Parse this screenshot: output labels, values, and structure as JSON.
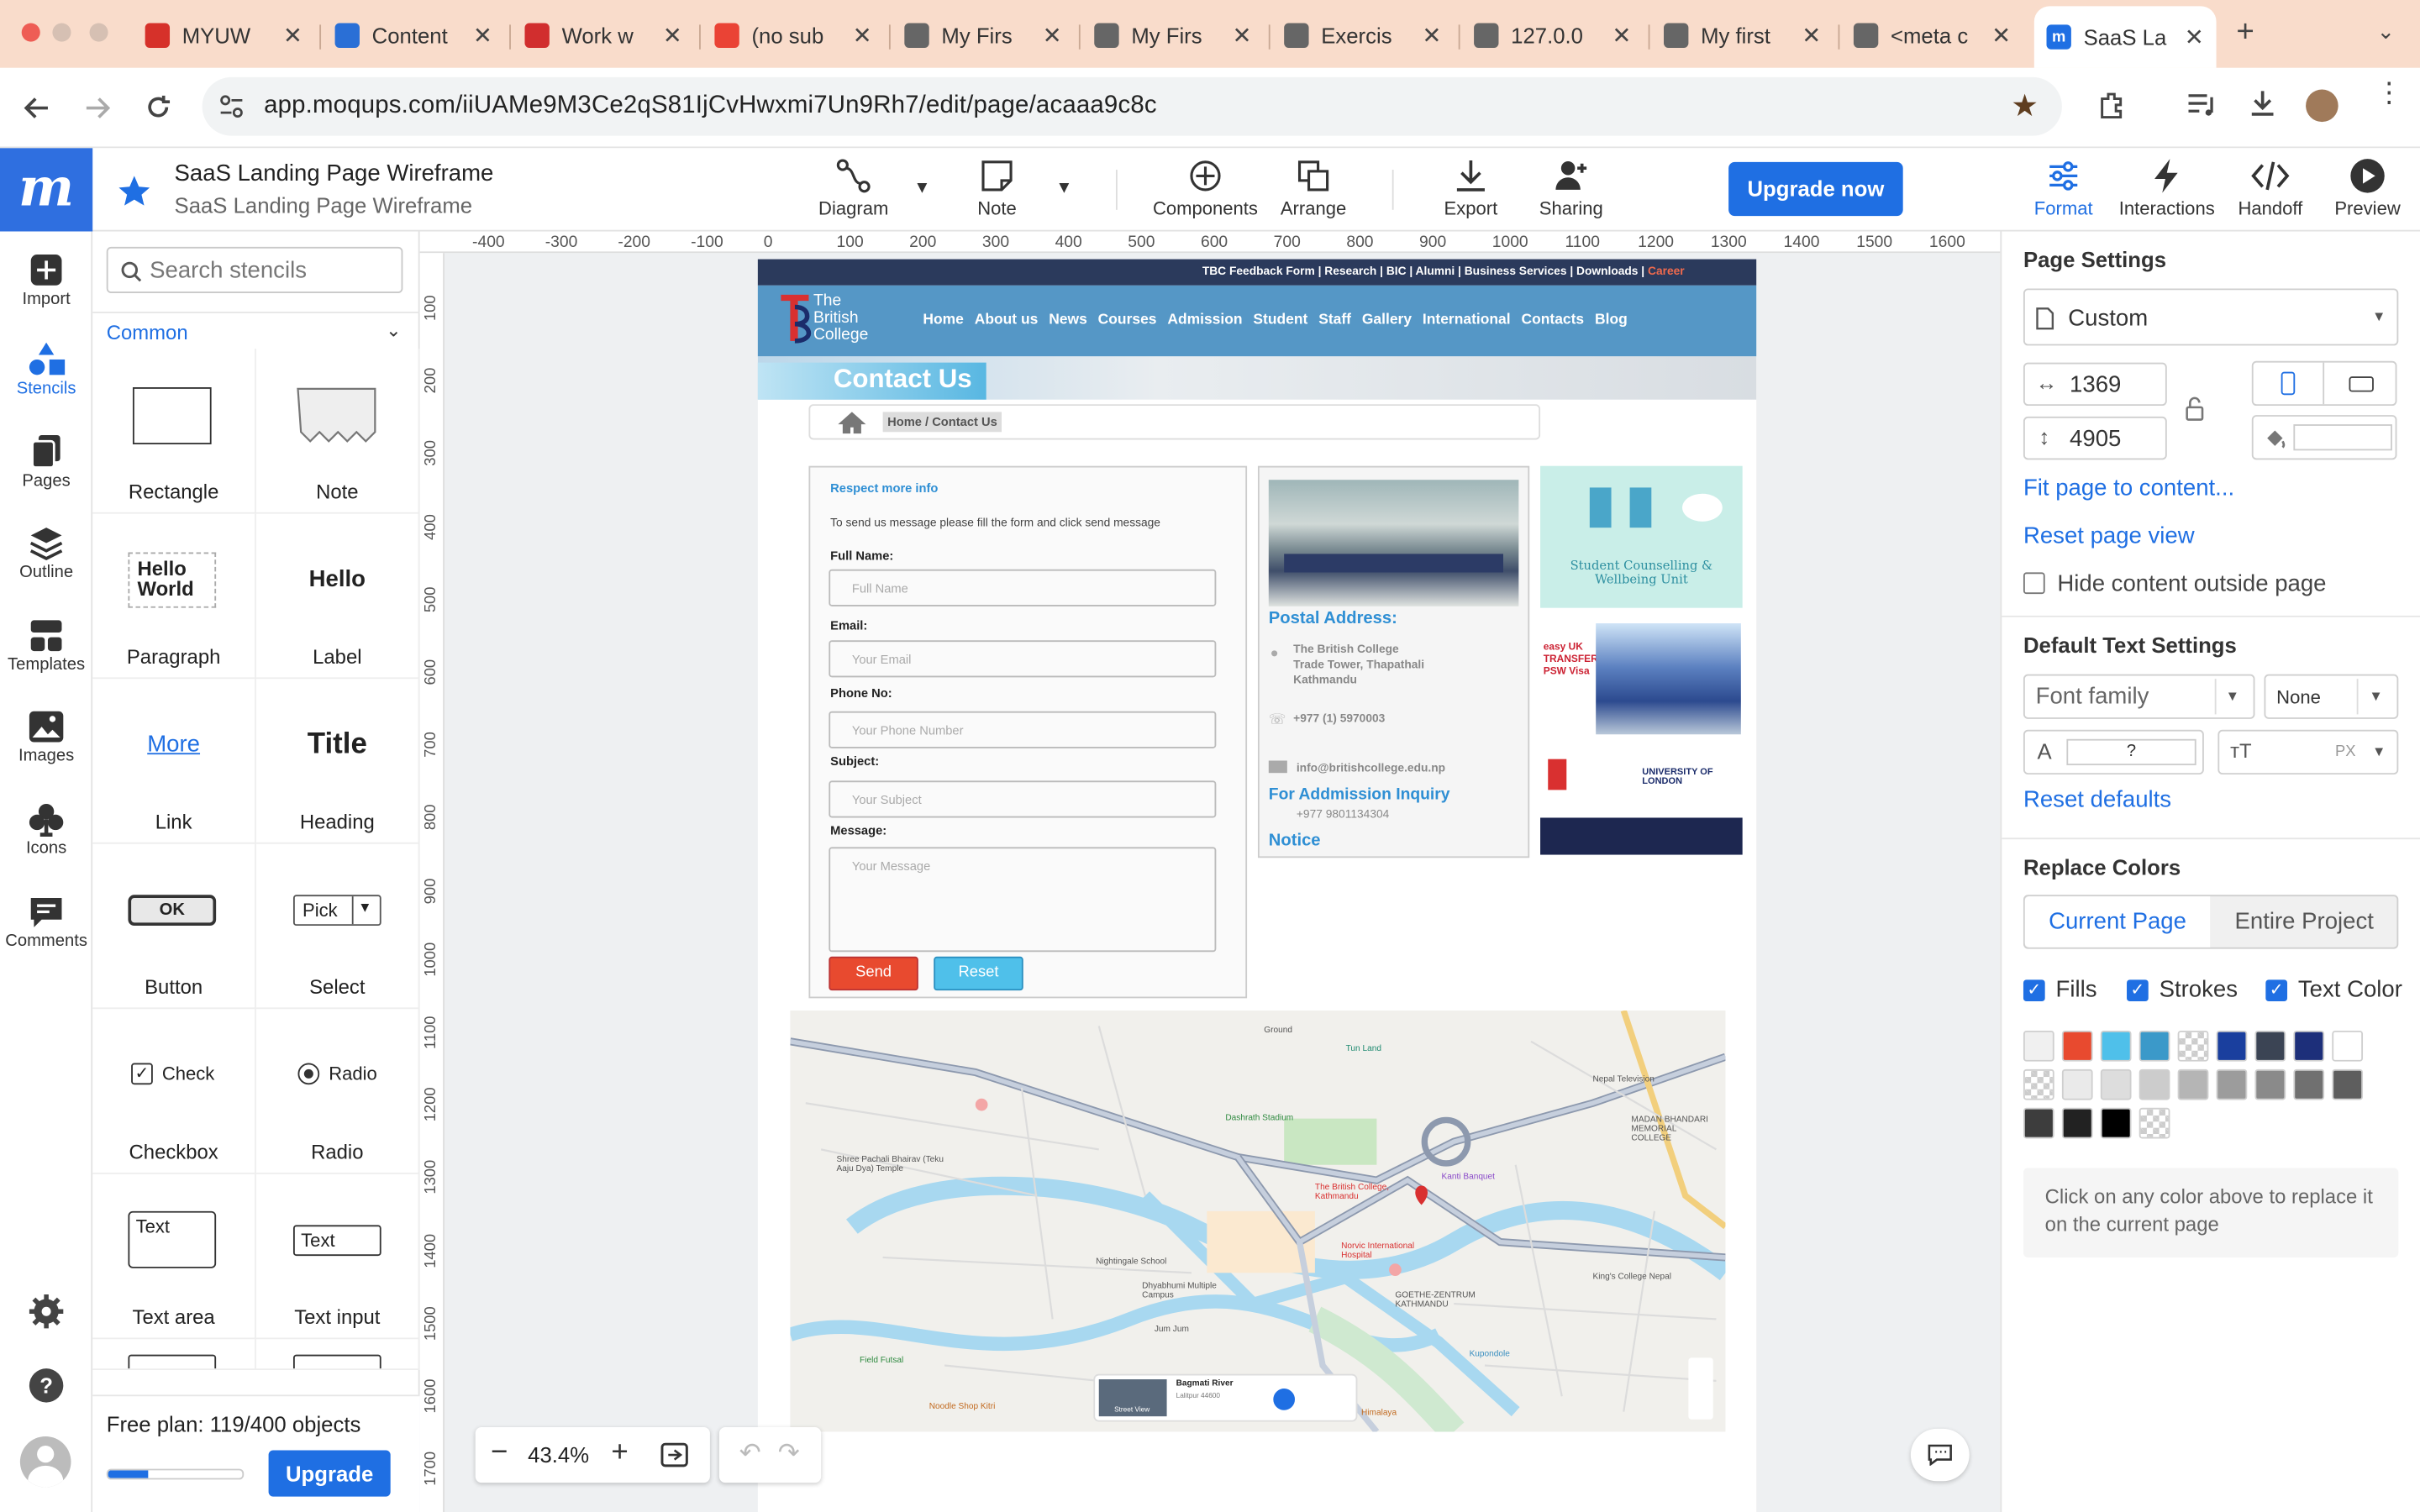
{
  "browser": {
    "tabs": [
      {
        "label": "MYUW",
        "icon": "myuwe-favicon",
        "color": "#d6312a"
      },
      {
        "label": "Content",
        "icon": "google-drive-favicon",
        "color": "#2a6fd6"
      },
      {
        "label": "Work w",
        "icon": "work-favicon",
        "color": "#d12e2e"
      },
      {
        "label": "(no sub",
        "icon": "gmail-favicon",
        "color": "#ea4335"
      },
      {
        "label": "My Firs",
        "icon": "globe-icon",
        "color": "#666"
      },
      {
        "label": "My Firs",
        "icon": "globe-icon",
        "color": "#666"
      },
      {
        "label": "Exercis",
        "icon": "globe-icon",
        "color": "#666"
      },
      {
        "label": "127.0.0",
        "icon": "globe-icon",
        "color": "#666"
      },
      {
        "label": "My first",
        "icon": "globe-icon",
        "color": "#666"
      },
      {
        "label": "<meta c",
        "icon": "globe-icon",
        "color": "#666"
      }
    ],
    "active_tab": {
      "label": "SaaS La",
      "icon": "moqups-favicon"
    },
    "url": "app.moqups.com/iiUAMe9M3Ce2qS81IjCvHwxmi7Un9Rh7/edit/page/acaaa9c8c"
  },
  "app": {
    "project_title": "SaaS Landing Page Wireframe",
    "page_title": "SaaS Landing Page Wireframe",
    "toolbar": {
      "diagram": "Diagram",
      "note": "Note",
      "components": "Components",
      "arrange": "Arrange",
      "export": "Export",
      "sharing": "Sharing",
      "upgrade_now": "Upgrade now",
      "format": "Format",
      "interactions": "Interactions",
      "handoff": "Handoff",
      "preview": "Preview"
    },
    "rail": [
      "Import",
      "Stencils",
      "Pages",
      "Outline",
      "Templates",
      "Images",
      "Icons",
      "Comments"
    ]
  },
  "stencils": {
    "search_placeholder": "Search stencils",
    "category": "Common",
    "items": [
      {
        "label": "Rectangle",
        "preview": ""
      },
      {
        "label": "Note",
        "preview": ""
      },
      {
        "label": "Paragraph",
        "preview": "Hello World"
      },
      {
        "label": "Label",
        "preview": "Hello"
      },
      {
        "label": "Link",
        "preview": "More"
      },
      {
        "label": "Heading",
        "preview": "Title"
      },
      {
        "label": "Button",
        "preview": "OK"
      },
      {
        "label": "Select",
        "preview": "Pick"
      },
      {
        "label": "Checkbox",
        "preview": "Check"
      },
      {
        "label": "Radio",
        "preview": "Radio"
      },
      {
        "label": "Text area",
        "preview": "Text"
      },
      {
        "label": "Text input",
        "preview": "Text"
      }
    ],
    "plan": "Free plan: 119/400 objects",
    "plan_progress": 0.2975,
    "upgrade": "Upgrade"
  },
  "canvas": {
    "ruler_h": [
      "-400",
      "-300",
      "-200",
      "-100",
      "0",
      "100",
      "200",
      "300",
      "400",
      "500",
      "600",
      "700",
      "800",
      "900",
      "1000",
      "1100",
      "1200",
      "1300",
      "1400",
      "1500",
      "1600"
    ],
    "ruler_v": [
      "100",
      "200",
      "300",
      "400",
      "500",
      "600",
      "700",
      "800",
      "900",
      "1000",
      "1100",
      "1200",
      "1300",
      "1400",
      "1500",
      "1600",
      "1700"
    ],
    "zoom": "43.4%"
  },
  "site": {
    "topbar": "TBC Feedback Form | Research | BIC | Alumni | Business Services | Downloads |",
    "topbar_career": "Career",
    "logo_text": "The British College",
    "nav": [
      "Home",
      "About us",
      "News",
      "Courses",
      "Admission",
      "Student",
      "Staff",
      "Gallery",
      "International",
      "Contacts",
      "Blog"
    ],
    "page_heading": "Contact Us",
    "breadcrumb": "Home / Contact Us",
    "form": {
      "heading": "Respect more info",
      "intro": "To send us message please fill the form and click send message",
      "fields": [
        {
          "label": "Full Name:",
          "placeholder": "Full Name"
        },
        {
          "label": "Email:",
          "placeholder": "Your Email"
        },
        {
          "label": "Phone No:",
          "placeholder": "Your Phone Number"
        },
        {
          "label": "Subject:",
          "placeholder": "Your Subject"
        }
      ],
      "message_label": "Message:",
      "message_placeholder": "Your Message",
      "send": "Send",
      "reset": "Reset"
    },
    "postal": {
      "heading": "Postal Address:",
      "address": [
        "The British College",
        "Trade Tower, Thapathali",
        "Kathmandu"
      ],
      "phone": "+977 (1) 5970003",
      "email": "info@britishcollege.edu.np",
      "admission_heading": "For Addmission Inquiry",
      "admission_phone": "+977 9801134304",
      "notice": "Notice"
    },
    "ads": {
      "ad1": "Student Counselling & Wellbeing Unit",
      "ad2": "easy UK TRANSFER PSW Visa",
      "ad3": "UNIVERSITY OF LONDON"
    },
    "map_labels": [
      "Ground",
      "Tun Land",
      "Nepal Television",
      "MADAN BHANDARI MEMORIAL COLLEGE",
      "Dashrath Stadium",
      "Shree Pachali Bhairav (Teku Aaju Dya) Temple",
      "The British College, Kathmandu",
      "Kanti Banquet",
      "Norvic International Hospital",
      "Nightingale School",
      "Dhyabhumi Multiple Campus",
      "GOETHE-ZENTRUM KATHMANDU",
      "King's College Nepal",
      "Field Futsal",
      "Noodle Shop Kitri",
      "Jum Jum",
      "Himalaya",
      "Kupondole",
      "Bagmati River",
      "Lalitpur 44600",
      "Street View"
    ]
  },
  "format": {
    "page_settings": "Page Settings",
    "preset": "Custom",
    "width": "1369",
    "height": "4905",
    "fit_page": "Fit page to content...",
    "reset_view": "Reset page view",
    "hide_outside": "Hide content outside page",
    "default_text": "Default Text Settings",
    "font_family": "Font family",
    "font_weight": "None",
    "text_color": "?",
    "font_unit": "PX",
    "reset_defaults": "Reset defaults",
    "replace_colors": "Replace Colors",
    "current_page": "Current Page",
    "entire_project": "Entire Project",
    "fills": "Fills",
    "strokes": "Strokes",
    "text_color_label": "Text Color",
    "swatches": [
      "#f0f0f0",
      "#e84a2f",
      "#4fc0ea",
      "#3b99c9",
      "checker",
      "#1a3f9e",
      "#3b4454",
      "#1d2f7a",
      "#ffffff",
      "checker",
      "#eaeaea",
      "#dddddd",
      "#cccccc",
      "#b5b5b5",
      "#9c9c9c",
      "#8a8a8a",
      "#707070",
      "#5e5e5e",
      "#3d3d3d",
      "#222222",
      "#000000",
      "checker"
    ],
    "hint": "Click on any color above to replace it on the current page"
  }
}
